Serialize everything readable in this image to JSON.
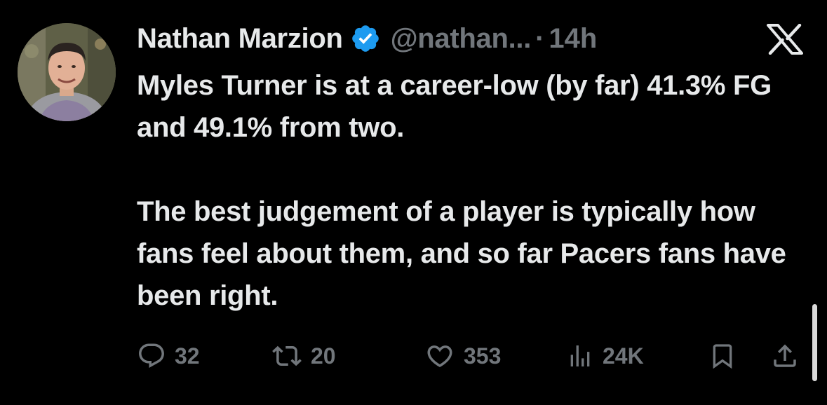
{
  "author": {
    "display_name": "Nathan Marzion",
    "handle": "@nathan...",
    "separator": "·",
    "time": "14h",
    "verified": true
  },
  "tweet": {
    "paragraph_1": "Myles Turner is at a career-low (by far) 41.3% FG and 49.1% from two.",
    "paragraph_2": "The best judgement of a player is typically how fans feel about them, and so far Pacers fans have been right."
  },
  "actions": {
    "replies": "32",
    "retweets": "20",
    "likes": "353",
    "views": "24K"
  },
  "icons": {
    "platform_logo": "x-logo-icon",
    "verified": "verified-badge-icon",
    "reply": "reply-icon",
    "retweet": "retweet-icon",
    "like": "heart-icon",
    "views": "views-icon",
    "bookmark": "bookmark-icon",
    "share": "share-icon"
  },
  "colors": {
    "background": "#000000",
    "text": "#e7e9ea",
    "muted": "#71767b",
    "verified": "#1d9bf0"
  }
}
